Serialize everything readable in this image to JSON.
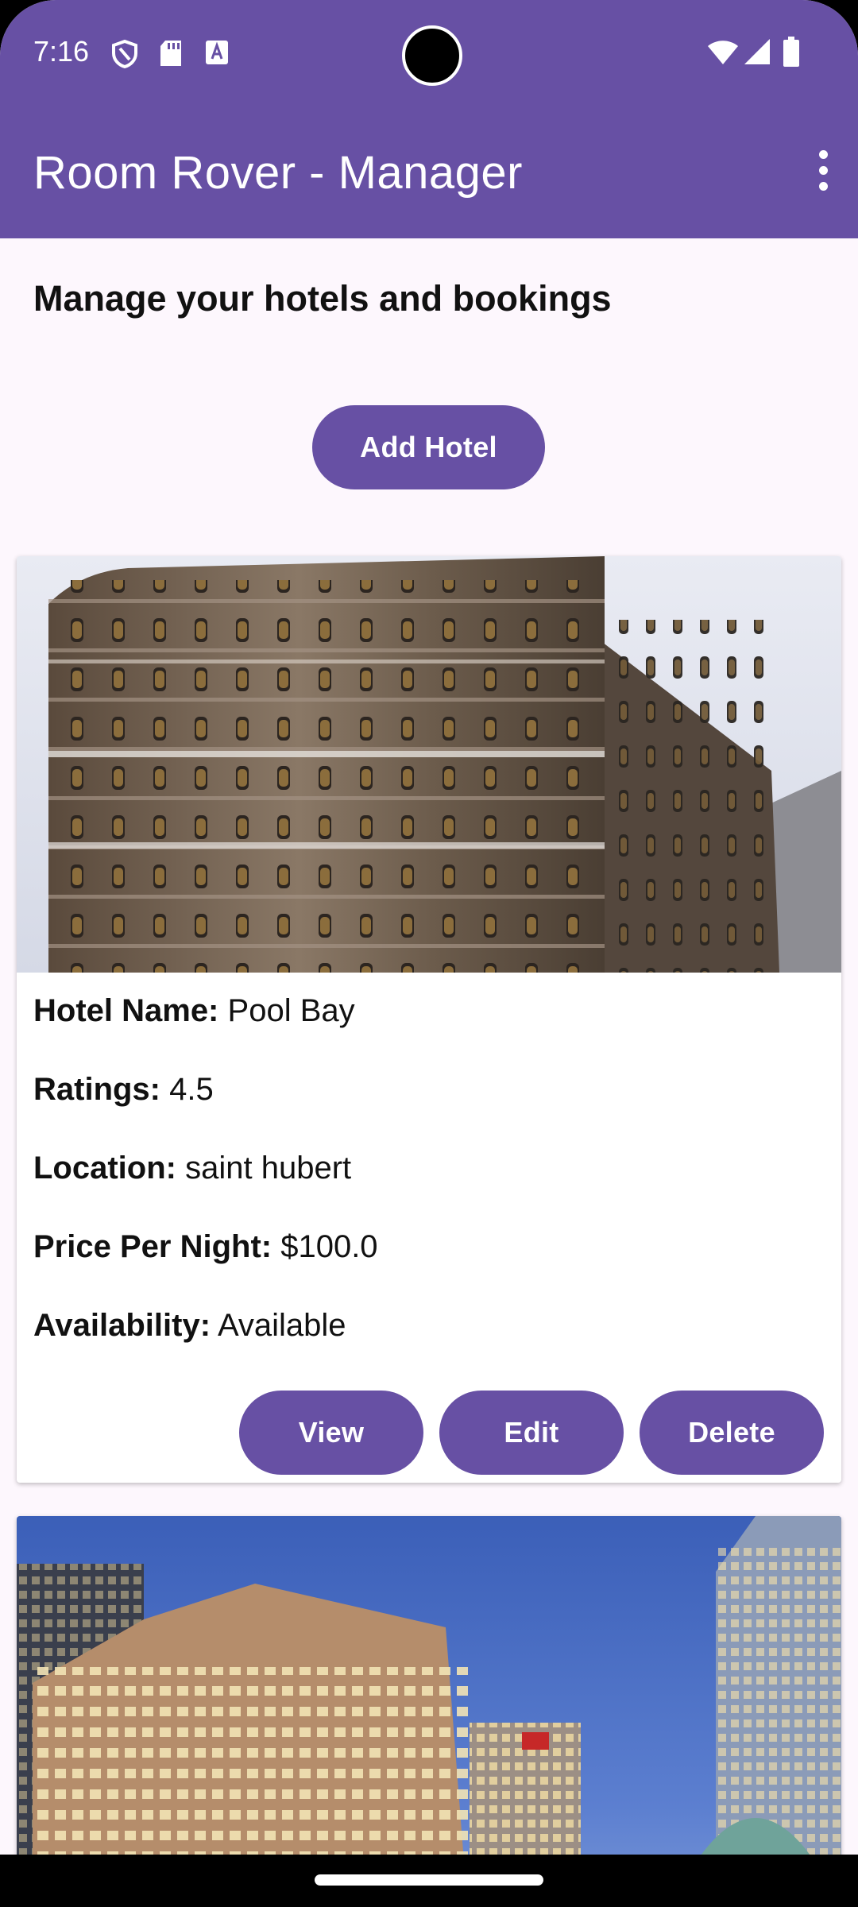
{
  "status_bar": {
    "time": "7:16"
  },
  "app_bar": {
    "title": "Room Rover - Manager"
  },
  "main": {
    "subtitle": "Manage your hotels and bookings",
    "add_button_label": "Add Hotel"
  },
  "hotels": [
    {
      "name_label": "Hotel Name:",
      "name": "Pool Bay",
      "ratings_label": "Ratings:",
      "ratings": "4.5",
      "location_label": "Location:",
      "location": "saint hubert",
      "price_label": "Price Per Night:",
      "price": "$100.0",
      "availability_label": "Availability:",
      "availability": "Available",
      "buttons": {
        "view": "View",
        "edit": "Edit",
        "delete": "Delete"
      }
    }
  ],
  "colors": {
    "primary": "#6750a4",
    "background": "#fdf7fd"
  }
}
